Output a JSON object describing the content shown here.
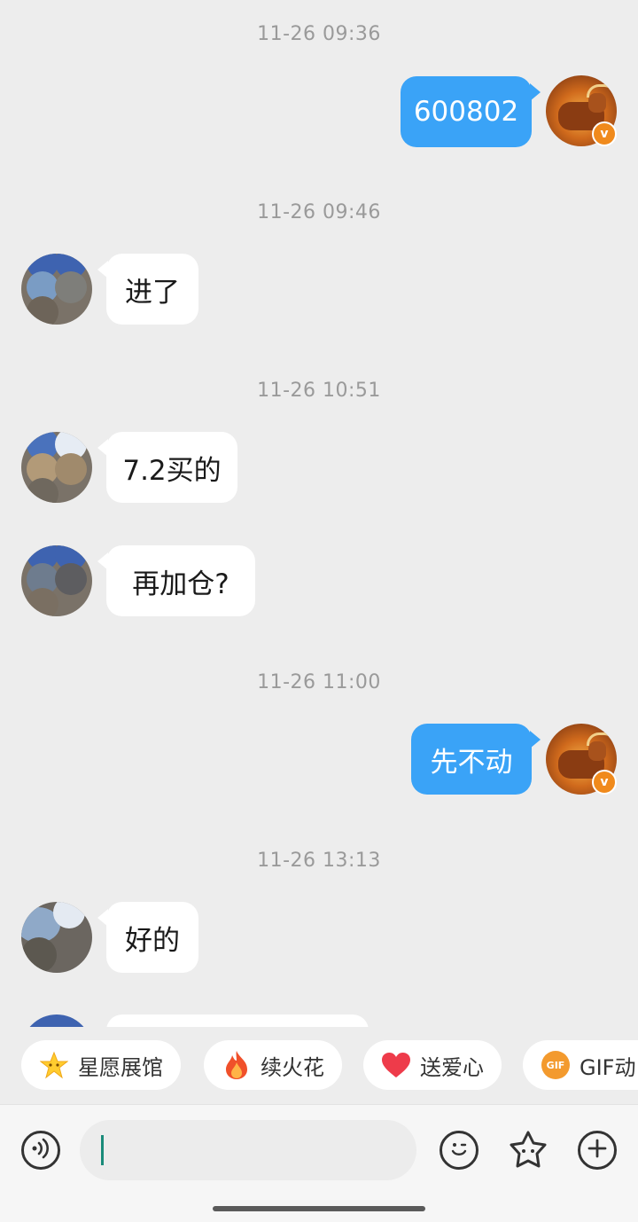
{
  "chat": {
    "messages": [
      {
        "timestamp": "11-26 09:36",
        "side": "out",
        "text": "600802"
      },
      {
        "timestamp": "11-26 09:46",
        "side": "in",
        "text": "进了"
      },
      {
        "timestamp": "11-26 10:51",
        "side": "in",
        "text": "7.2买的"
      },
      {
        "side": "in",
        "text": "再加仓?"
      },
      {
        "timestamp": "11-26 11:00",
        "side": "out",
        "text": "先不动"
      },
      {
        "timestamp": "11-26 13:13",
        "side": "in",
        "text": "好的"
      }
    ],
    "verified_badge": "v"
  },
  "quick_actions": [
    {
      "label": "星愿展馆",
      "icon": "star-icon"
    },
    {
      "label": "续火花",
      "icon": "fire-icon"
    },
    {
      "label": "送爱心",
      "icon": "heart-icon"
    },
    {
      "label": "GIF动",
      "icon": "gif-icon",
      "icon_text": "GIF"
    }
  ],
  "input_bar": {
    "placeholder": "",
    "buttons": [
      "voice-icon",
      "emoji-icon",
      "sticker-star-icon",
      "plus-icon"
    ]
  },
  "colors": {
    "outgoing_bubble": "#3aa3f7",
    "incoming_bubble": "#ffffff",
    "background": "#ededed"
  }
}
